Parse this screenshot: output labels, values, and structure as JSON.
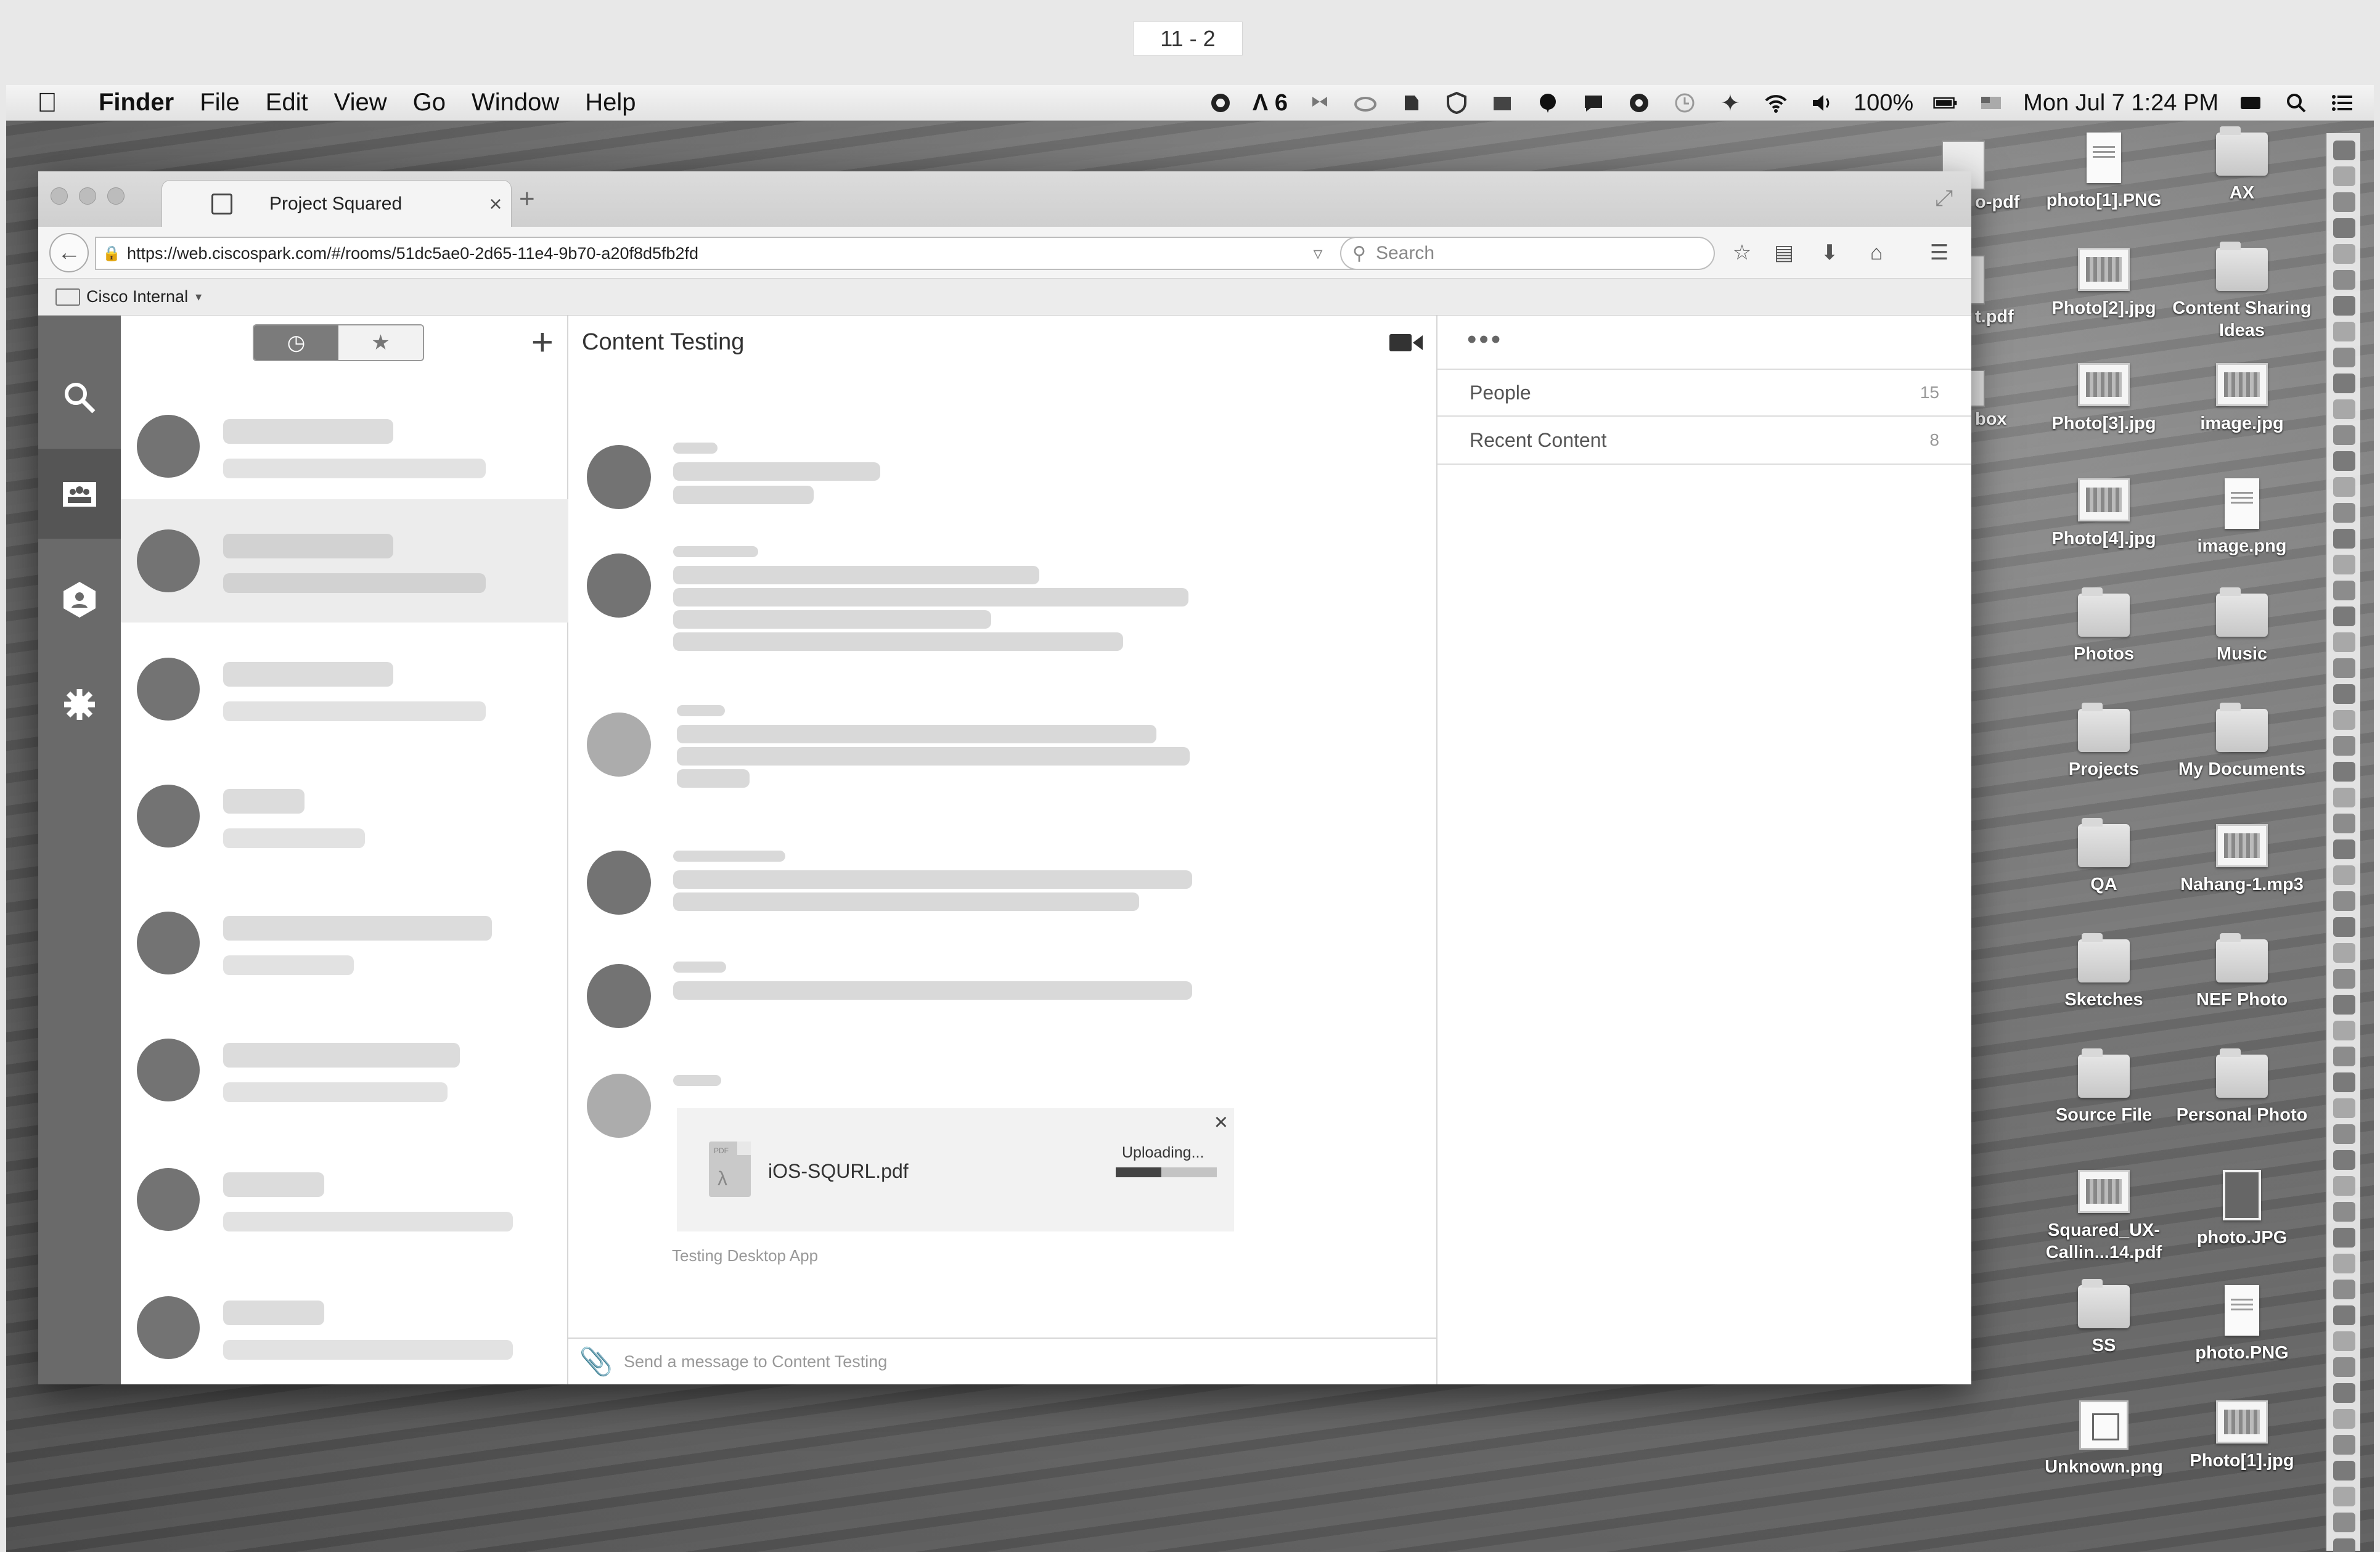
{
  "page_label": "11 - 2",
  "menubar": {
    "app_name": "Finder",
    "menus": [
      "File",
      "Edit",
      "View",
      "Go",
      "Window",
      "Help"
    ],
    "adobe_count": "6",
    "battery": "100%",
    "datetime": "Mon Jul 7  1:24 PM"
  },
  "browser": {
    "tab_title": "Project Squared",
    "url": "https://web.ciscospark.com/#/rooms/51dc5ae0-2d65-11e4-9b70-a20f8d5fb2fd",
    "search_placeholder": "Search",
    "bookmark_folder": "Cisco Internal"
  },
  "app": {
    "room_title": "Content Testing",
    "attachment": {
      "file_name": "iOS-SQURL.pdf",
      "status": "Uploading...",
      "progress": 0.45
    },
    "message_meta": "Testing Desktop App",
    "composer_placeholder": "Send a message to Content Testing",
    "details": {
      "people_label": "People",
      "people_count": "15",
      "recent_label": "Recent Content",
      "recent_count": "8"
    }
  },
  "desktop_icons": [
    {
      "label": "photo[1].PNG",
      "type": "doc"
    },
    {
      "label": "AX",
      "type": "folder"
    },
    {
      "label": "Photo[2].jpg",
      "type": "image"
    },
    {
      "label": "Content Sharing Ideas",
      "type": "folder"
    },
    {
      "label": "Photo[3].jpg",
      "type": "image"
    },
    {
      "label": "image.jpg",
      "type": "image"
    },
    {
      "label": "Photo[4].jpg",
      "type": "image"
    },
    {
      "label": "image.png",
      "type": "doc"
    },
    {
      "label": "Photos",
      "type": "folder"
    },
    {
      "label": "Music",
      "type": "folder"
    },
    {
      "label": "Projects",
      "type": "folder"
    },
    {
      "label": "My Documents",
      "type": "folder"
    },
    {
      "label": "QA",
      "type": "folder"
    },
    {
      "label": "Nahang-1.mp3",
      "type": "image"
    },
    {
      "label": "Sketches",
      "type": "folder"
    },
    {
      "label": "NEF Photo",
      "type": "folder"
    },
    {
      "label": "Source File",
      "type": "folder"
    },
    {
      "label": "Personal Photo",
      "type": "folder"
    },
    {
      "label": "Squared_UX-Callin...14.pdf",
      "type": "image"
    },
    {
      "label": "photo.JPG",
      "type": "photo"
    },
    {
      "label": "SS",
      "type": "folder"
    },
    {
      "label": "photo.PNG",
      "type": "doc"
    },
    {
      "label": "Unknown.png",
      "type": "unknown"
    },
    {
      "label": "Photo[1].jpg",
      "type": "image"
    }
  ],
  "partial_icons": [
    "o-pdf",
    "t.pdf",
    "box"
  ]
}
